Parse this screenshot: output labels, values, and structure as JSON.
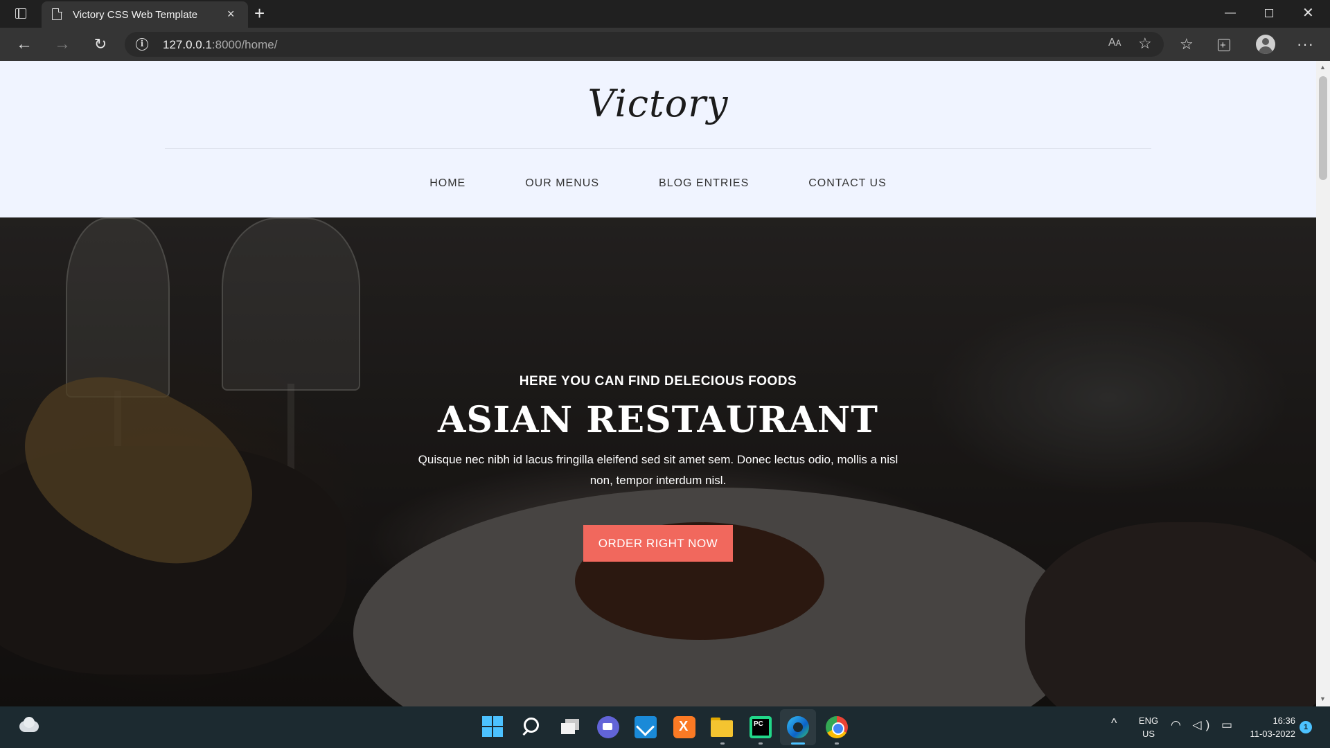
{
  "browser": {
    "tab_title": "Victory CSS Web Template",
    "tab_close": "×",
    "new_tab": "+",
    "url_host": "127.0.0.1",
    "url_rest": ":8000/home/",
    "read_aloud": "Aᴀ",
    "favorite_add": "☆",
    "favorites": "☆",
    "more": "···",
    "back": "←",
    "forward": "→",
    "reload": "↻",
    "info": "i",
    "win_min": "—",
    "win_close": "✕"
  },
  "site": {
    "logo": "Victory",
    "nav": [
      "HOME",
      "OUR MENUS",
      "BLOG ENTRIES",
      "CONTACT US"
    ],
    "hero": {
      "subtitle": "HERE YOU CAN FIND DELECIOUS FOODS",
      "title": "ASIAN RESTAURANT",
      "text": "Quisque nec nibh id lacus fringilla eleifend sed sit amet sem. Donec lectus odio, mollis a nisl non, tempor interdum nisl.",
      "button": "ORDER RIGHT NOW"
    }
  },
  "scrollbar": {
    "up": "▲",
    "down": "▼"
  },
  "taskbar": {
    "chevron": "^",
    "lang_line1": "ENG",
    "lang_line2": "US",
    "tray_icons": "wifi-icon volume-icon battery-icon",
    "tray_glyphs": "◠ ◁) ▭",
    "time": "16:36",
    "date": "11-03-2022",
    "notifications": "1"
  }
}
